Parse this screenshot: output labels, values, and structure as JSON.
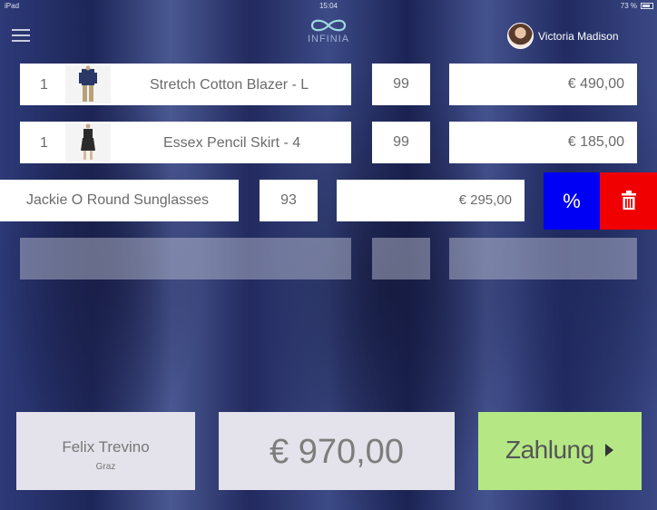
{
  "status_bar": {
    "device": "iPad",
    "time": "15:04",
    "battery": "73 %"
  },
  "header": {
    "logo_text": "INFINIA",
    "user_name": "Victoria Madison"
  },
  "cart": {
    "items": [
      {
        "qty": "1",
        "name": "Stretch Cotton Blazer - L",
        "code": "99",
        "price": "€ 490,00",
        "thumb_icon": "blazer-product-image"
      },
      {
        "qty": "1",
        "name": "Essex Pencil Skirt - 4",
        "code": "99",
        "price": "€ 185,00",
        "thumb_icon": "skirt-product-image"
      },
      {
        "name": "Jackie O Round Sunglasses",
        "code": "93",
        "price": "€ 295,00"
      }
    ],
    "actions": {
      "discount_label": "%",
      "delete_icon": "trash-icon"
    }
  },
  "footer": {
    "customer_name": "Felix Trevino",
    "customer_city": "Graz",
    "total": "€ 970,00",
    "pay_label": "Zahlung"
  },
  "colors": {
    "discount": "#0000f5",
    "delete": "#f00000",
    "pay": "#b5e885"
  }
}
